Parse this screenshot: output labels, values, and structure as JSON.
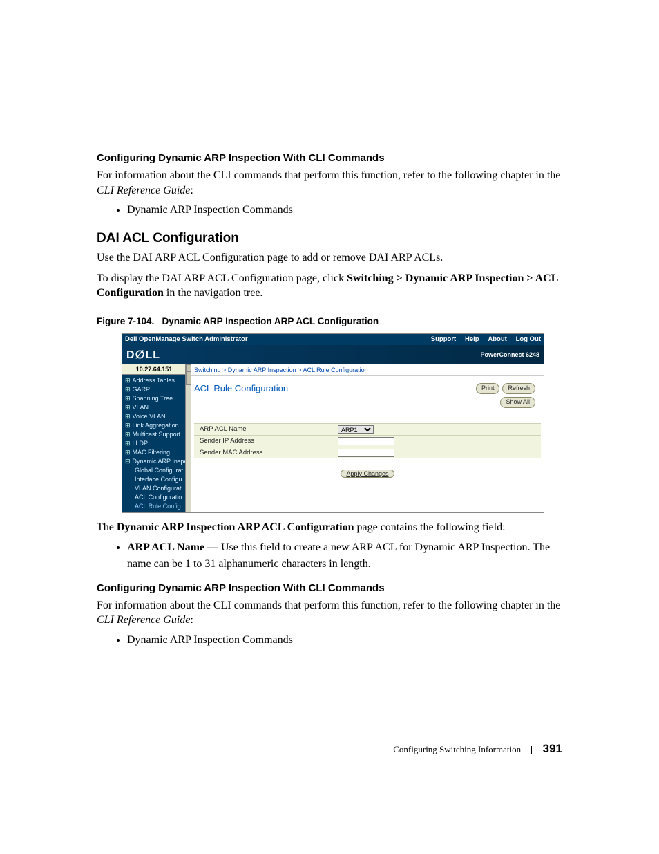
{
  "headings": {
    "cli1": "Configuring Dynamic ARP Inspection With CLI Commands",
    "dai": "DAI ACL Configuration",
    "cli2": "Configuring Dynamic ARP Inspection With CLI Commands"
  },
  "paragraphs": {
    "cli1_body_a": "For information about the CLI commands that perform this function, refer to the following chapter in the ",
    "cli1_body_ref": "CLI Reference Guide",
    "cli1_body_b": ":",
    "dai_p1": "Use the DAI ARP ACL Configuration page to add or remove DAI ARP ACLs.",
    "dai_p2_a": "To display the DAI ARP ACL Configuration page, click ",
    "dai_p2_b": "Switching > Dynamic ARP Inspection > ACL Configuration",
    "dai_p2_c": " in the navigation tree.",
    "postfig_a": "The ",
    "postfig_b": "Dynamic ARP Inspection ARP ACL Configuration",
    "postfig_c": " page contains the following field:",
    "field_name": "ARP ACL Name",
    "field_desc": " — Use this field to create a new ARP ACL for Dynamic ARP Inspection. The name can be 1 to 31 alphanumeric characters in length.",
    "cli2_body_a": "For information about the CLI commands that perform this function, refer to the following chapter in the ",
    "cli2_body_ref": "CLI Reference Guide",
    "cli2_body_b": ":"
  },
  "bullets": {
    "b1": "Dynamic ARP Inspection Commands",
    "b2": "Dynamic ARP Inspection Commands"
  },
  "figure": {
    "caption_no": "Figure 7-104.",
    "caption_txt": "Dynamic ARP Inspection ARP ACL Configuration",
    "top_title": "Dell OpenManage Switch Administrator",
    "menus": {
      "support": "Support",
      "help": "Help",
      "about": "About",
      "logout": "Log Out"
    },
    "pc": "PowerConnect 6248",
    "ip": "10.27.64.151",
    "tree": [
      "Address Tables",
      "GARP",
      "Spanning Tree",
      "VLAN",
      "Voice VLAN",
      "Link Aggregation",
      "Multicast Support",
      "LLDP",
      "MAC Filtering",
      "Dynamic ARP Inspe"
    ],
    "tree_sub": [
      "Global Configurat",
      "Interface Configu",
      "VLAN Configurati",
      "ACL Configuratio",
      "ACL Rule Config"
    ],
    "crumb_a": "Switching",
    "crumb_b": "Dynamic ARP Inspection",
    "crumb_c": "ACL Rule Configuration",
    "page_title": "ACL Rule Configuration",
    "btn_print": "Print",
    "btn_refresh": "Refresh",
    "btn_showall": "Show All",
    "form": {
      "row1": "ARP ACL Name",
      "row1_val": "ARP1",
      "row2": "Sender IP Address",
      "row3": "Sender MAC Address"
    },
    "btn_apply": "Apply Changes"
  },
  "footer": {
    "section": "Configuring Switching Information",
    "page": "391"
  }
}
